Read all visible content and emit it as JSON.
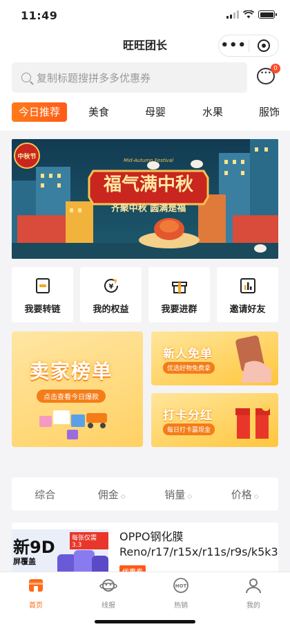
{
  "status": {
    "time": "11:49"
  },
  "nav": {
    "title": "旺旺团长"
  },
  "search": {
    "placeholder": "复制标题搜拼多多优惠券",
    "message_count": "0"
  },
  "tabs": [
    "今日推荐",
    "美食",
    "母婴",
    "水果",
    "服饰"
  ],
  "banner": {
    "badge": "中秋节",
    "headline": "福气满中秋",
    "subline": "齐聚中秋 圆满是福",
    "english": "Mid-Autumn Festival"
  },
  "quick_actions": [
    {
      "label": "我要转链",
      "icon": "link-card-icon"
    },
    {
      "label": "我的权益",
      "icon": "yen-refresh-icon"
    },
    {
      "label": "我要进群",
      "icon": "gift-box-icon"
    },
    {
      "label": "邀请好友",
      "icon": "bar-chart-icon"
    }
  ],
  "promos": {
    "seller_rank": {
      "title": "卖家榜单",
      "subtitle": "点击查看今日爆款"
    },
    "new_user": {
      "title": "新人免单",
      "subtitle": "优选好物免费拿"
    },
    "checkin": {
      "title": "打卡分红",
      "subtitle": "每日打卡赢现金"
    }
  },
  "sort": [
    {
      "label": "综合",
      "arrows": false
    },
    {
      "label": "佣金",
      "arrows": true
    },
    {
      "label": "销量",
      "arrows": true
    },
    {
      "label": "价格",
      "arrows": true
    }
  ],
  "product": {
    "name": "OPPO钢化膜 Reno/r17/r15x/r11s/r9s/k5k3",
    "thumb_text": "新9D",
    "thumb_sub": "屏覆盖",
    "thumb_note": "每张仅需3.3",
    "tag": "优惠券"
  },
  "tabbar": [
    {
      "label": "首页",
      "icon": "home-shop-icon",
      "active": true
    },
    {
      "label": "线报",
      "icon": "planet-icon",
      "active": false
    },
    {
      "label": "热销",
      "icon": "hot-icon",
      "active": false
    },
    {
      "label": "我的",
      "icon": "user-icon",
      "active": false
    }
  ],
  "colors": {
    "accent": "#ff6a1a",
    "promo_yellow": "#ffd164",
    "banner_red": "#c8261e"
  }
}
